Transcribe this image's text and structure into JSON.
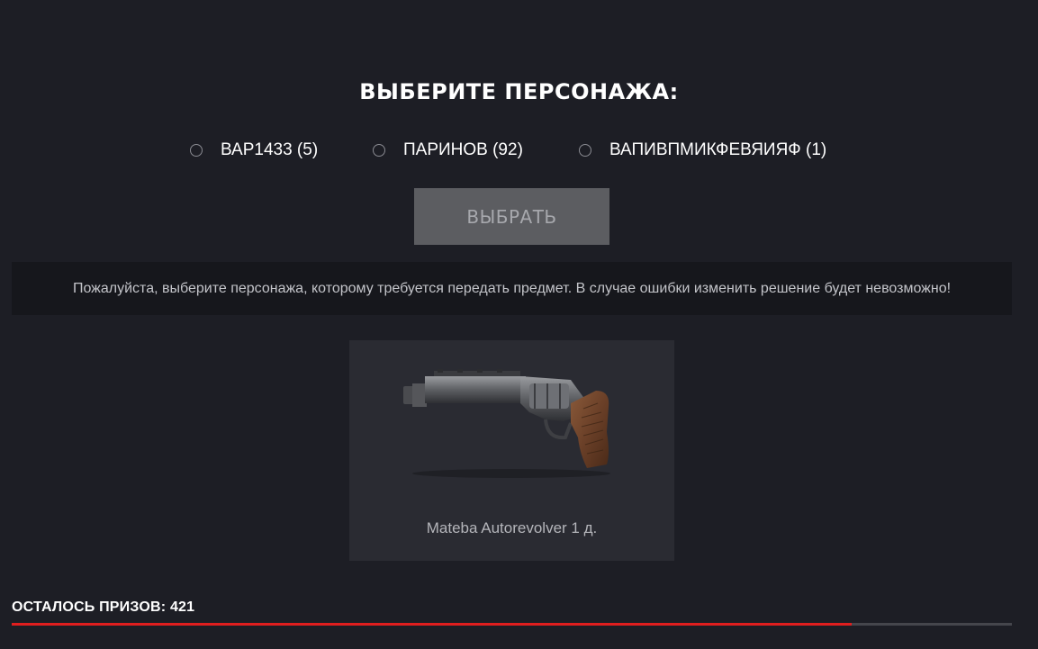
{
  "header": {
    "title": "ВЫБЕРИТЕ ПЕРСОНАЖА:"
  },
  "characters": [
    {
      "label": "ВАР1433 (5)",
      "selected": false
    },
    {
      "label": "ПАРИНОВ (92)",
      "selected": false
    },
    {
      "label": "ВАПИВПМИКФЕВЯИЯФ (1)",
      "selected": false
    }
  ],
  "select_button": {
    "label": "ВЫБРАТЬ",
    "disabled": true
  },
  "notice": {
    "text": "Пожалуйста, выберите персонажа, которому требуется передать предмет. В случае ошибки изменить решение будет невозможно!"
  },
  "item": {
    "name": "Mateba Autorevolver 1 д.",
    "icon": "revolver-image"
  },
  "prizes": {
    "label": "ОСТАЛОСЬ ПРИЗОВ: 421",
    "progress_fraction": 0.84
  },
  "colors": {
    "background": "#1d1e25",
    "accent_red": "#e01e1e",
    "button_bg": "#5c5d61",
    "card_bg": "#2a2b32"
  }
}
